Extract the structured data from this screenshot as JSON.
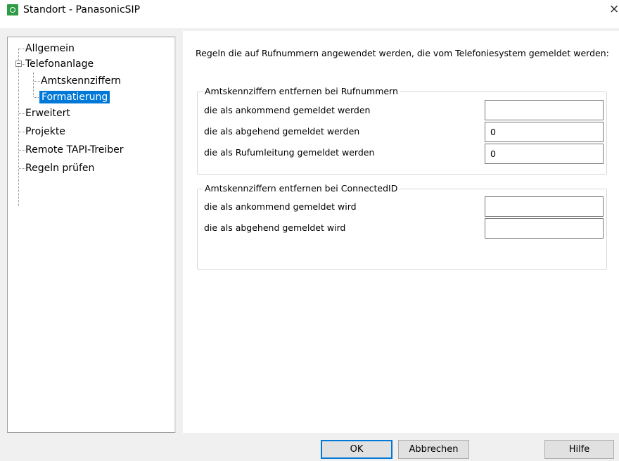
{
  "window": {
    "title": "Standort - PanasonicSIP",
    "close_glyph": "×",
    "icon": "app-icon"
  },
  "tree": {
    "items": [
      {
        "label": "Allgemein"
      },
      {
        "label": "Telefonanlage"
      },
      {
        "label": "Amtskennziffern"
      },
      {
        "label": "Formatierung",
        "selected": true
      },
      {
        "label": "Erweitert"
      },
      {
        "label": "Projekte"
      },
      {
        "label": "Remote TAPI-Treiber"
      },
      {
        "label": "Regeln prüfen"
      }
    ]
  },
  "main": {
    "intro": "Regeln die auf Rufnummern angewendet werden, die vom Telefoniesystem gemeldet werden:",
    "group1": {
      "title": "Amtskennziffern entfernen bei Rufnummern",
      "rows": [
        {
          "label": "die als ankommend gemeldet werden",
          "value": ""
        },
        {
          "label": "die als abgehend gemeldet werden",
          "value": "0"
        },
        {
          "label": "die als Rufumleitung gemeldet werden",
          "value": "0"
        }
      ]
    },
    "group2": {
      "title": "Amtskennziffern entfernen bei ConnectedID",
      "rows": [
        {
          "label": "die als ankommend gemeldet wird",
          "value": ""
        },
        {
          "label": "die als abgehend gemeldet wird",
          "value": ""
        }
      ]
    }
  },
  "footer": {
    "ok_label": "OK",
    "cancel_label": "Abbrechen",
    "help_label": "Hilfe"
  },
  "colors": {
    "selection": "#0078d7",
    "app_icon": "#2e9b45"
  }
}
